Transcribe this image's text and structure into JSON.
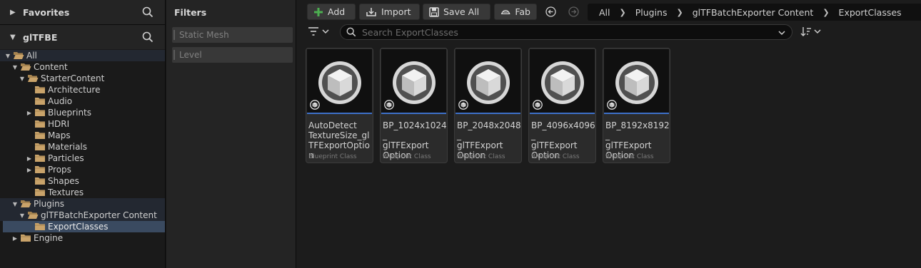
{
  "sidebar": {
    "favorites_label": "Favorites",
    "project_label": "glTFBE",
    "tree": [
      {
        "label": "All",
        "depth": 0,
        "expanded": true,
        "open": true,
        "band": true
      },
      {
        "label": "Content",
        "depth": 1,
        "expanded": true,
        "open": true
      },
      {
        "label": "StarterContent",
        "depth": 2,
        "expanded": true,
        "open": true
      },
      {
        "label": "Architecture",
        "depth": 3
      },
      {
        "label": "Audio",
        "depth": 3
      },
      {
        "label": "Blueprints",
        "depth": 3,
        "collapsed": true
      },
      {
        "label": "HDRI",
        "depth": 3
      },
      {
        "label": "Maps",
        "depth": 3
      },
      {
        "label": "Materials",
        "depth": 3
      },
      {
        "label": "Particles",
        "depth": 3,
        "collapsed": true
      },
      {
        "label": "Props",
        "depth": 3,
        "collapsed": true
      },
      {
        "label": "Shapes",
        "depth": 3
      },
      {
        "label": "Textures",
        "depth": 3
      },
      {
        "label": "Plugins",
        "depth": 1,
        "expanded": true,
        "open": true,
        "band": true
      },
      {
        "label": "glTFBatchExporter Content",
        "depth": 2,
        "expanded": true,
        "open": true,
        "band": true
      },
      {
        "label": "ExportClasses",
        "depth": 3,
        "selected": true
      },
      {
        "label": "Engine",
        "depth": 1,
        "collapsed": true
      }
    ]
  },
  "filters": {
    "title": "Filters",
    "items": [
      "Static Mesh",
      "Level"
    ]
  },
  "toolbar": {
    "add_label": "Add",
    "import_label": "Import",
    "save_all_label": "Save All",
    "fab_label": "Fab"
  },
  "breadcrumb": [
    "All",
    "Plugins",
    "glTFBatchExporter Content",
    "ExportClasses"
  ],
  "search": {
    "placeholder": "Search ExportClasses",
    "value": ""
  },
  "assets": [
    {
      "name": "AutoDetect\nTextureSize_gl\nTFExportOption",
      "type": "Blueprint Class"
    },
    {
      "name": "BP_1024x1024_\nglTFExport\nOption",
      "type": "Blueprint Class"
    },
    {
      "name": "BP_2048x2048_\nglTFExport\nOption",
      "type": "Blueprint Class"
    },
    {
      "name": "BP_4096x4096_\nglTFExport\nOption",
      "type": "Blueprint Class"
    },
    {
      "name": "BP_8192x8192_\nglTFExport\nOption",
      "type": "Blueprint Class"
    }
  ],
  "colors": {
    "folder": "#c9a36a",
    "folder_dark": "#a5834f",
    "add_plus": "#4caf50",
    "asset_underline": "#3d70c9",
    "selection": "#3a4a60"
  },
  "icons": [
    "search-icon",
    "folder-icon",
    "plus-icon",
    "import-icon",
    "save-icon",
    "fab-icon",
    "back-icon",
    "forward-icon",
    "filter-icon",
    "sort-icon",
    "blueprint-class-icon"
  ]
}
